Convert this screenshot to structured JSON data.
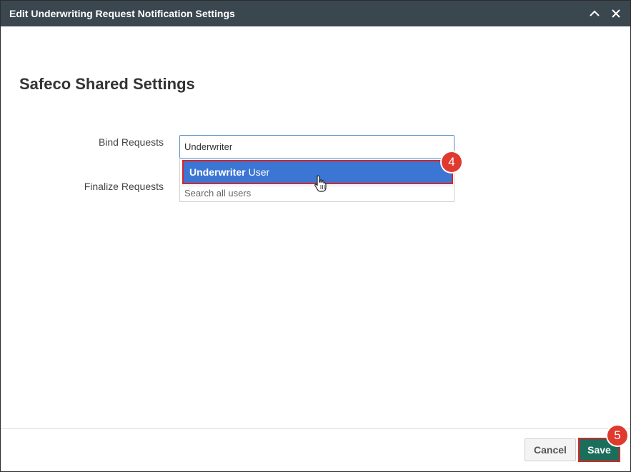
{
  "dialog": {
    "title": "Edit Underwriting Request Notification Settings",
    "minimize_icon": "chevron-up-icon",
    "close_icon": "close-icon"
  },
  "section": {
    "heading": "Safeco Shared Settings"
  },
  "fields": {
    "bind_label": "Bind Requests",
    "bind_value": "Underwriter",
    "finalize_label": "Finalize Requests"
  },
  "dropdown": {
    "option_match": "Underwriter",
    "option_rest": "User",
    "search_all": "Search all users"
  },
  "steps": {
    "step4": "4",
    "step5": "5"
  },
  "footer": {
    "cancel_label": "Cancel",
    "save_label": "Save"
  },
  "colors": {
    "titlebar": "#3b474f",
    "highlight": "#3b76d4",
    "save": "#1a6e5b",
    "badge": "#e03a2f",
    "annotation_outline": "#d92525"
  }
}
